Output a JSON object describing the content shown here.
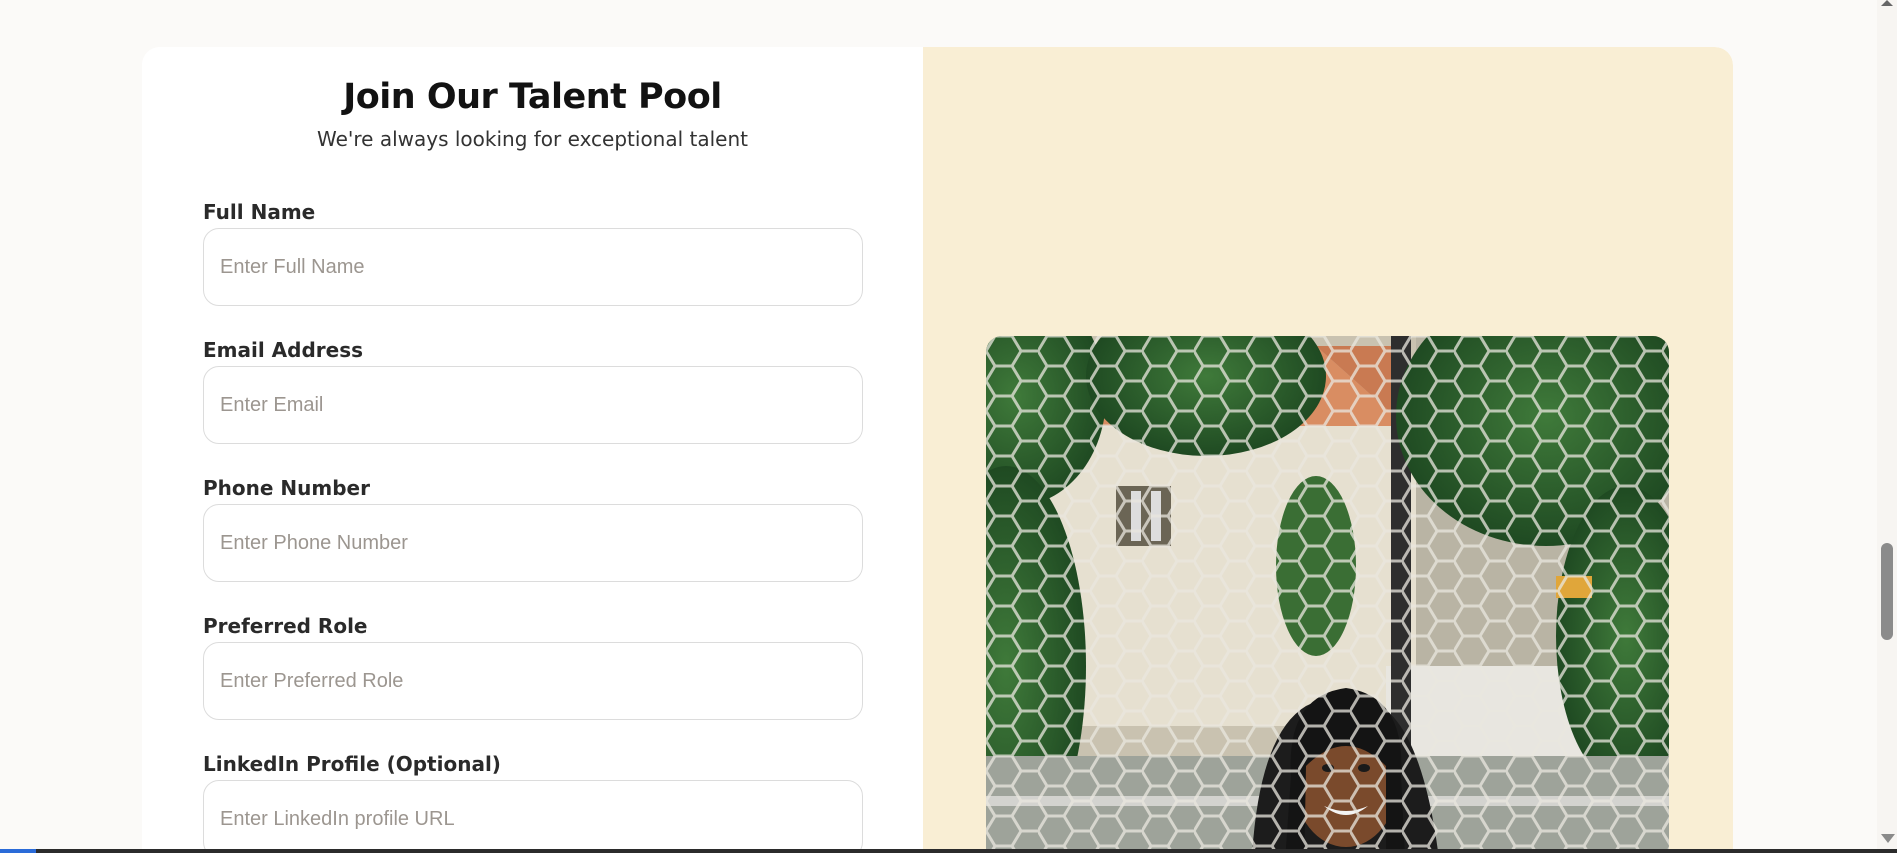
{
  "form": {
    "title": "Join Our Talent Pool",
    "subtitle": "We're always looking for exceptional talent",
    "fields": [
      {
        "label": "Full Name",
        "placeholder": "Enter Full Name",
        "value": ""
      },
      {
        "label": "Email Address",
        "placeholder": "Enter Email",
        "value": ""
      },
      {
        "label": "Phone Number",
        "placeholder": "Enter Phone Number",
        "value": ""
      },
      {
        "label": "Preferred Role",
        "placeholder": "Enter Preferred Role",
        "value": ""
      },
      {
        "label": "LinkedIn Profile (Optional)",
        "placeholder": "Enter LinkedIn profile URL",
        "value": ""
      }
    ]
  },
  "colors": {
    "page_background": "#fbfaf8",
    "image_panel_background": "#f9eed4",
    "input_border": "#dcdcdc",
    "placeholder": "#9c9690"
  },
  "image": {
    "subject": "smiling woman with braids in front of a house behind a hexagonal wire fence"
  }
}
